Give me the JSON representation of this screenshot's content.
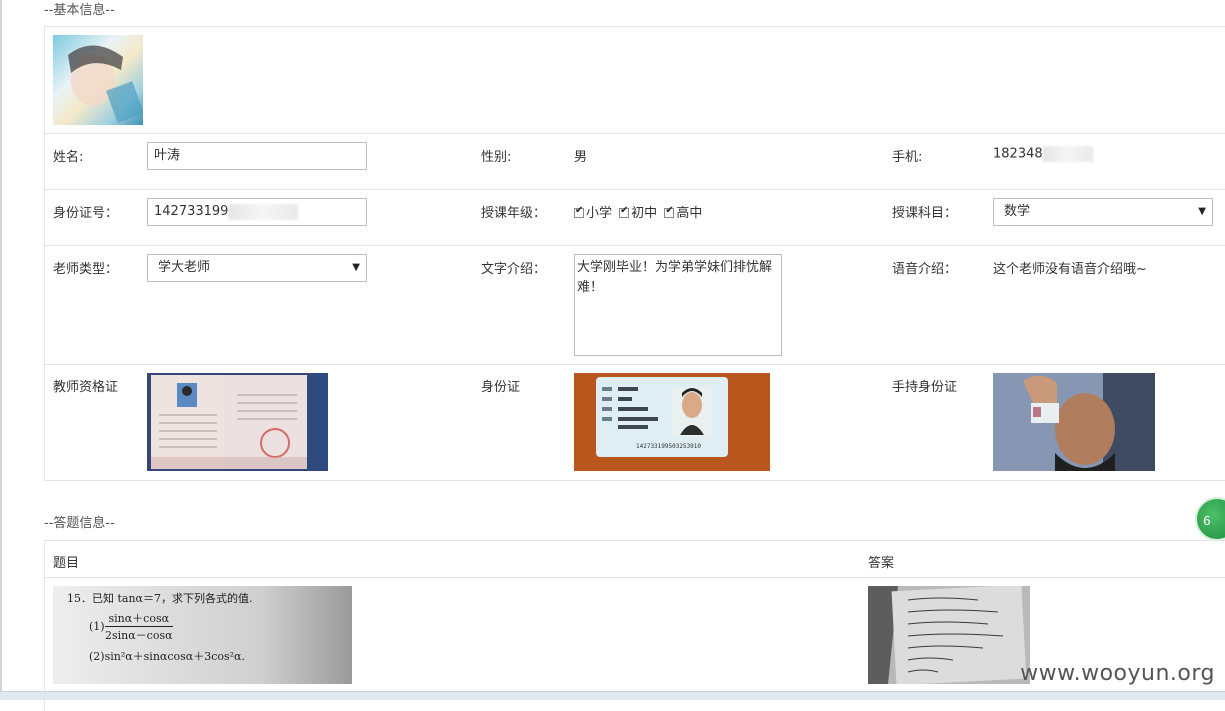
{
  "basic_section": {
    "title": "--基本信息--"
  },
  "profile": {
    "name_label": "姓名:",
    "name_value": "叶涛",
    "gender_label": "性别:",
    "gender_value": "男",
    "phone_label": "手机:",
    "phone_value": "182348",
    "id_label": "身份证号：",
    "id_value": "142733199",
    "grade_label": "授课年级：",
    "grades": [
      "小学",
      "初中",
      "高中"
    ],
    "subject_label": "授课科目：",
    "subject_value": "数学",
    "teacher_type_label": "老师类型：",
    "teacher_type_value": "学大老师",
    "text_intro_label": "文字介绍：",
    "text_intro_value": "大学刚毕业！为学弟学妹们排忧解难！",
    "voice_intro_label": "语音介绍：",
    "voice_intro_value": "这个老师没有语音介绍哦~",
    "cert_label": "教师资格证",
    "idcard_label": "身份证",
    "hold_idcard_label": "手持身份证"
  },
  "answers_section": {
    "title": "--答题信息--",
    "col_question": "题目",
    "col_answer": "答案",
    "question_line1": "15．已知 tanα＝7，求下列各式的值.",
    "question_frac_num": "sinα＋cosα",
    "question_frac_den": "2sinα－cosα",
    "question_item1": "(1)",
    "question_item2": "(2)sin²α＋sinαcosα＋3cos²α."
  },
  "id_card": {
    "name": "叶 涛",
    "number": "142733199503253910"
  },
  "float_badge": "6",
  "watermark": "www.wooyun.org",
  "colors": {
    "border": "#e5e5e5",
    "float_green": "#2e9e4b"
  }
}
